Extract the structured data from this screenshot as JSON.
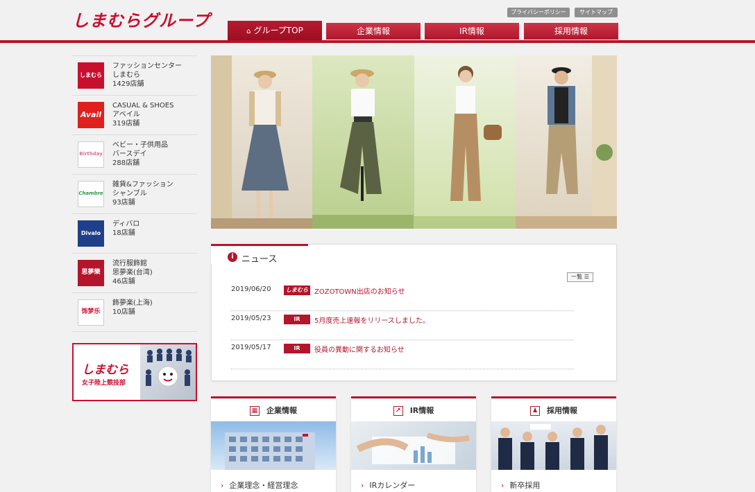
{
  "brand": {
    "logo_text": "しまむらグループ",
    "accent": "#b5152b"
  },
  "util_links": [
    "プライバシーポリシー",
    "サイトマップ"
  ],
  "nav_tabs": [
    {
      "label": "グループTOP",
      "icon": "home-icon",
      "active": true
    },
    {
      "label": "企業情報",
      "active": false
    },
    {
      "label": "IR情報",
      "active": false
    },
    {
      "label": "採用情報",
      "active": false
    }
  ],
  "sidebar": {
    "items": [
      {
        "logo": "しまむら",
        "line1": "ファッションセンター",
        "line2": "しまむら",
        "line3": "1429店舗"
      },
      {
        "logo": "Avail",
        "line1": "CASUAL & SHOES",
        "line2": "アベイル",
        "line3": "319店舗"
      },
      {
        "logo": "Birthday",
        "line1": "ベビー・子供用品",
        "line2": "バースデイ",
        "line3": "288店舗"
      },
      {
        "logo": "Chambre",
        "line1": "雑貨&ファッション",
        "line2": "シャンブル",
        "line3": "93店舗"
      },
      {
        "logo": "Divalo",
        "line1": "ディバロ",
        "line2": "18店舗",
        "line3": ""
      },
      {
        "logo": "思夢樂",
        "line1": "流行服飾館",
        "line2": "思夢楽(台湾)",
        "line3": "46店舗"
      },
      {
        "logo": "饰梦乐",
        "line1": "飾夢楽(上海)",
        "line2": "10店舗",
        "line3": ""
      }
    ],
    "banner": {
      "line1": "しまむら",
      "line2": "女子陸上競技部"
    }
  },
  "news": {
    "title": "ニュース",
    "list_button": "一覧",
    "items": [
      {
        "date": "2019/06/20",
        "tag": "しまむら",
        "text": "ZOZOTOWN出店のお知らせ"
      },
      {
        "date": "2019/05/23",
        "tag": "IR",
        "text": "5月度売上速報をリリースしました。"
      },
      {
        "date": "2019/05/17",
        "tag": "IR",
        "text": "役員の異動に関するお知らせ"
      }
    ]
  },
  "cards": [
    {
      "title": "企業情報",
      "icon": "building-icon",
      "link": "企業理念・経営理念"
    },
    {
      "title": "IR情報",
      "icon": "chart-icon",
      "link": "IRカレンダー"
    },
    {
      "title": "採用情報",
      "icon": "person-icon",
      "link": "新卒採用"
    }
  ]
}
